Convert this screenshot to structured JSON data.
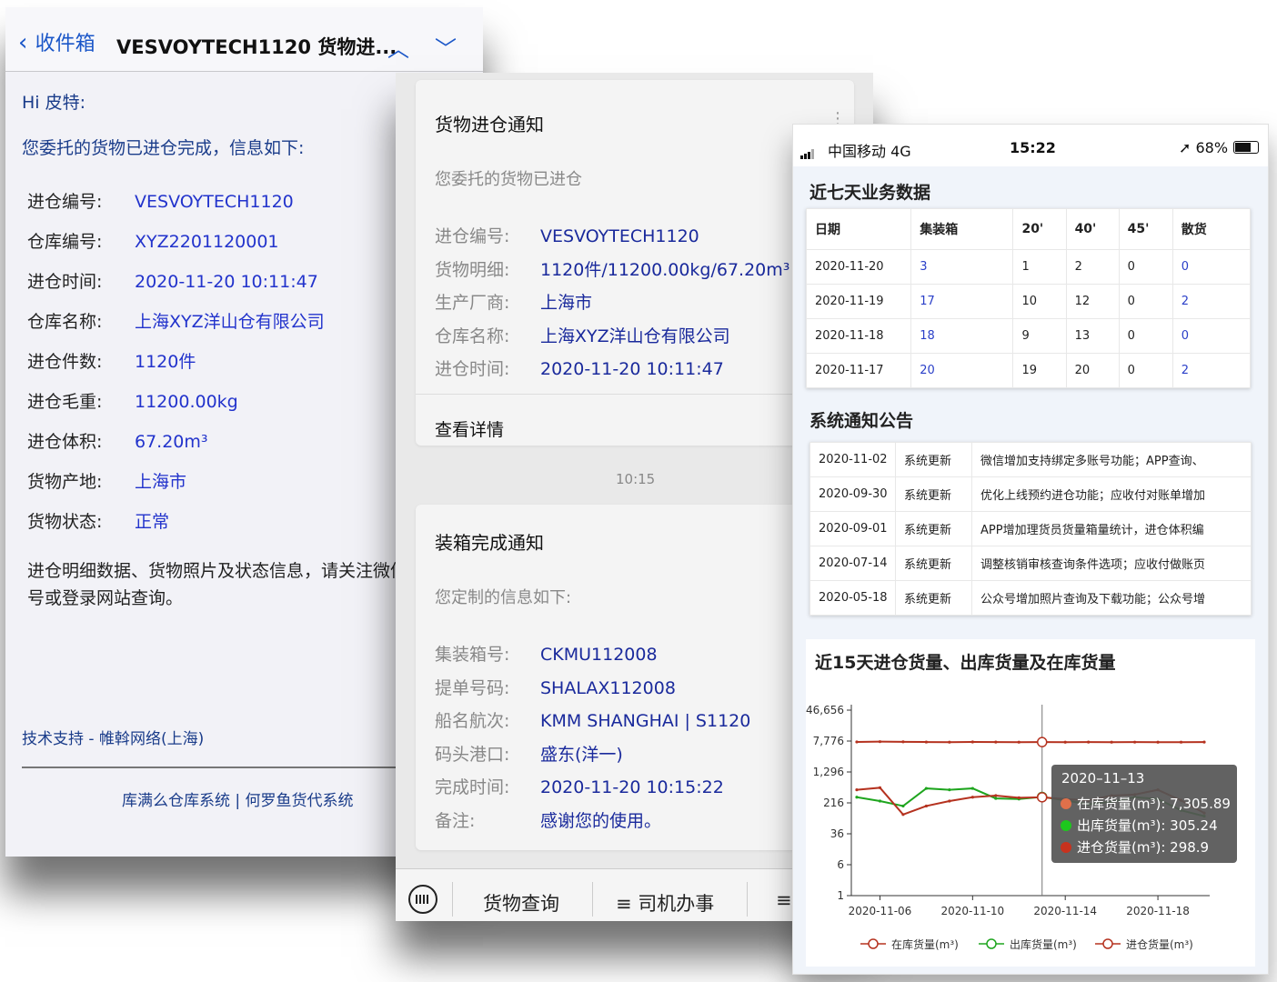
{
  "email": {
    "back_label": "收件箱",
    "subject": "VESVOYTECH1120 货物进...",
    "greeting": "Hi 皮特:",
    "intro": "您委托的货物已进仓完成，信息如下:",
    "fields": [
      {
        "k": "进仓编号:",
        "v": "VESVOYTECH1120"
      },
      {
        "k": "仓库编号:",
        "v": "XYZ2201120001"
      },
      {
        "k": "进仓时间:",
        "v": "2020-11-20 10:11:47"
      },
      {
        "k": "仓库名称:",
        "v": "上海XYZ洋山仓有限公司"
      },
      {
        "k": "进仓件数:",
        "v": "1120件"
      },
      {
        "k": "进仓毛重:",
        "v": "11200.00kg"
      },
      {
        "k": "进仓体积:",
        "v": "67.20m³"
      },
      {
        "k": "货物产地:",
        "v": "上海市"
      },
      {
        "k": "货物状态:",
        "v": "正常"
      }
    ],
    "note": "进仓明细数据、货物照片及状态信息，请关注微信公众号或登录网站查询。",
    "support": "技术支持 - 帷斡网络(上海)",
    "footer": "库满么仓库系统 | 何罗鱼货代系统"
  },
  "wechat": {
    "card1": {
      "title": "货物进仓通知",
      "subtitle": "您委托的货物已进仓",
      "fields": [
        {
          "k": "进仓编号:",
          "v": "VESVOYTECH1120"
        },
        {
          "k": "货物明细:",
          "v": "1120件/11200.00kg/67.20m³"
        },
        {
          "k": "生产厂商:",
          "v": "上海市"
        },
        {
          "k": "仓库名称:",
          "v": "上海XYZ洋山仓有限公司"
        },
        {
          "k": "进仓时间:",
          "v": "2020-11-20 10:11:47"
        }
      ],
      "detail": "查看详情"
    },
    "time": "10:15",
    "card2": {
      "title": "装箱完成通知",
      "subtitle": "您定制的信息如下:",
      "fields": [
        {
          "k": "集装箱号:",
          "v": "CKMU112008"
        },
        {
          "k": "提单号码:",
          "v": "SHALAX112008"
        },
        {
          "k": "船名航次:",
          "v": "KMM SHANGHAI | S1120"
        },
        {
          "k": "码头港口:",
          "v": "盛东(洋一)"
        },
        {
          "k": "完成时间:",
          "v": "2020-11-20 10:15:22"
        },
        {
          "k": "备注:",
          "v": "感谢您的使用。"
        }
      ]
    },
    "menu": [
      "货物查询",
      "≡ 司机办事",
      "≡"
    ]
  },
  "phone": {
    "status": {
      "carrier": "中国移动  4G",
      "time": "15:22",
      "battery": "68%"
    },
    "biz_title": "近七天业务数据",
    "biz_headers": [
      "日期",
      "集装箱",
      "20'",
      "40'",
      "45'",
      "散货"
    ],
    "biz_rows": [
      [
        "2020-11-20",
        "3",
        "1",
        "2",
        "0",
        "0"
      ],
      [
        "2020-11-19",
        "17",
        "10",
        "12",
        "0",
        "2"
      ],
      [
        "2020-11-18",
        "18",
        "9",
        "13",
        "0",
        "0"
      ],
      [
        "2020-11-17",
        "20",
        "19",
        "20",
        "0",
        "2"
      ]
    ],
    "notice_title": "系统通知公告",
    "notices": [
      [
        "2020-11-02",
        "系统更新",
        "微信增加支持绑定多账号功能；APP查询、"
      ],
      [
        "2020-09-30",
        "系统更新",
        "优化上线预约进仓功能；应收付对账单增加"
      ],
      [
        "2020-09-01",
        "系统更新",
        "APP增加理货员货量箱量统计，进仓体积编"
      ],
      [
        "2020-07-14",
        "系统更新",
        "调整核销审核查询条件选项；应收付做账页"
      ],
      [
        "2020-05-18",
        "系统更新",
        "公众号增加照片查询及下载功能；公众号增"
      ]
    ]
  },
  "chart_data": {
    "type": "line",
    "title": "近15天进仓货量、出库货量及在库货量",
    "y_scale": "log",
    "y_ticks": [
      "1",
      "6",
      "36",
      "216",
      "1,296",
      "7,776",
      "46,656"
    ],
    "x_ticks": [
      "2020-11-06",
      "2020-11-10",
      "2020-11-14",
      "2020-11-18"
    ],
    "x": [
      "2020-11-05",
      "2020-11-06",
      "2020-11-07",
      "2020-11-08",
      "2020-11-09",
      "2020-11-10",
      "2020-11-11",
      "2020-11-12",
      "2020-11-13",
      "2020-11-14",
      "2020-11-15",
      "2020-11-16",
      "2020-11-17",
      "2020-11-18",
      "2020-11-19",
      "2020-11-20"
    ],
    "series": [
      {
        "name": "在库货量(m³)",
        "color": "#b5321f",
        "values": [
          7400,
          7500,
          7450,
          7350,
          7300,
          7380,
          7320,
          7300,
          7305.89,
          7280,
          7320,
          7300,
          7310,
          7290,
          7300,
          7320
        ]
      },
      {
        "name": "出库货量(m³)",
        "color": "#1ea51e",
        "values": [
          300,
          240,
          180,
          500,
          460,
          500,
          280,
          270,
          305.24,
          250,
          200,
          230,
          300,
          270,
          140,
          100
        ]
      },
      {
        "name": "进仓货量(m³)",
        "color": "#b5321f",
        "values": [
          460,
          520,
          110,
          180,
          240,
          300,
          330,
          290,
          298.9,
          270,
          250,
          330,
          350,
          460,
          250,
          120
        ]
      }
    ],
    "tooltip": {
      "date": "2020–11–13",
      "lines": [
        "在库货量(m³): 7,305.89",
        "出库货量(m³): 305.24",
        "进仓货量(m³): 298.9"
      ]
    },
    "legend": [
      "在库货量(m³)",
      "出库货量(m³)",
      "进仓货量(m³)"
    ],
    "legend_position": "bottom"
  }
}
